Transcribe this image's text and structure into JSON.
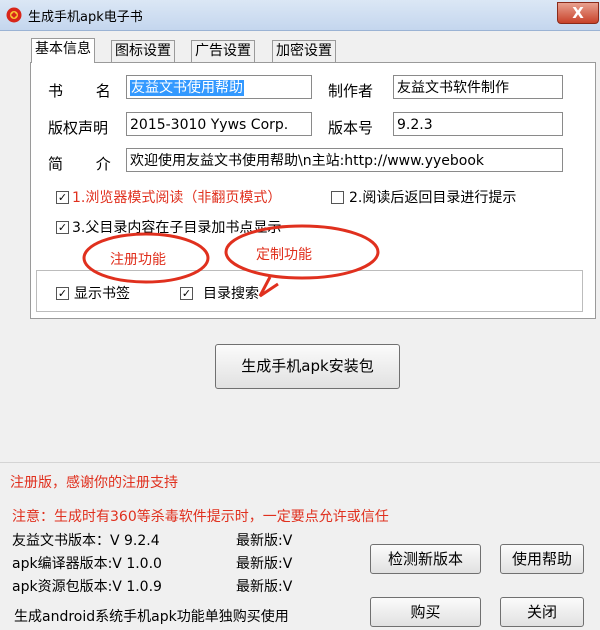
{
  "window": {
    "title": "生成手机apk电子书",
    "close_label": "X"
  },
  "tabs": [
    {
      "label": "基本信息"
    },
    {
      "label": "图标设置"
    },
    {
      "label": "广告设置"
    },
    {
      "label": "加密设置"
    }
  ],
  "form": {
    "book_name_label": "书  名",
    "book_name_value": "友益文书使用帮助",
    "producer_label": "制作者",
    "producer_value": "友益文书软件制作",
    "copyright_label": "版权声明",
    "copyright_value": "2015-3010 Yyws Corp.",
    "version_label": "版本号",
    "version_value": "9.2.3",
    "intro_label": "简  介",
    "intro_value": "欢迎使用友益文书使用帮助\\n主站:http://www.yyebook"
  },
  "options": {
    "browser_mode": {
      "label": "1.浏览器模式阅读（非翻页模式）",
      "checked": true
    },
    "return_prompt": {
      "label": "2.阅读后返回目录进行提示",
      "checked": false
    },
    "parent_dir": {
      "label": "3.父目录内容在子目录加书点显示",
      "checked": true
    },
    "show_bookmark": {
      "label": "显示书签",
      "checked": true
    },
    "dir_search": {
      "label": "目录搜索",
      "checked": true
    }
  },
  "annotations": {
    "register": "注册功能",
    "custom": "定制功能",
    "color": "#e0301e"
  },
  "generate_button": "生成手机apk安装包",
  "status": {
    "registered": "注册版，感谢你的注册支持",
    "warning": "注意：生成时有360等杀毒软件提示时，一定要点允许或信任",
    "versions": [
      {
        "label": "友益文书版本：V 9.2.4",
        "latest": "最新版:V"
      },
      {
        "label": "apk编译器版本:V 1.0.0",
        "latest": "最新版:V"
      },
      {
        "label": "apk资源包版本:V 1.0.9",
        "latest": "最新版:V"
      }
    ],
    "purchase_note": "生成android系统手机apk功能单独购买使用"
  },
  "buttons": {
    "check_update": "检测新版本",
    "help": "使用帮助",
    "buy": "购买",
    "close": "关闭"
  }
}
